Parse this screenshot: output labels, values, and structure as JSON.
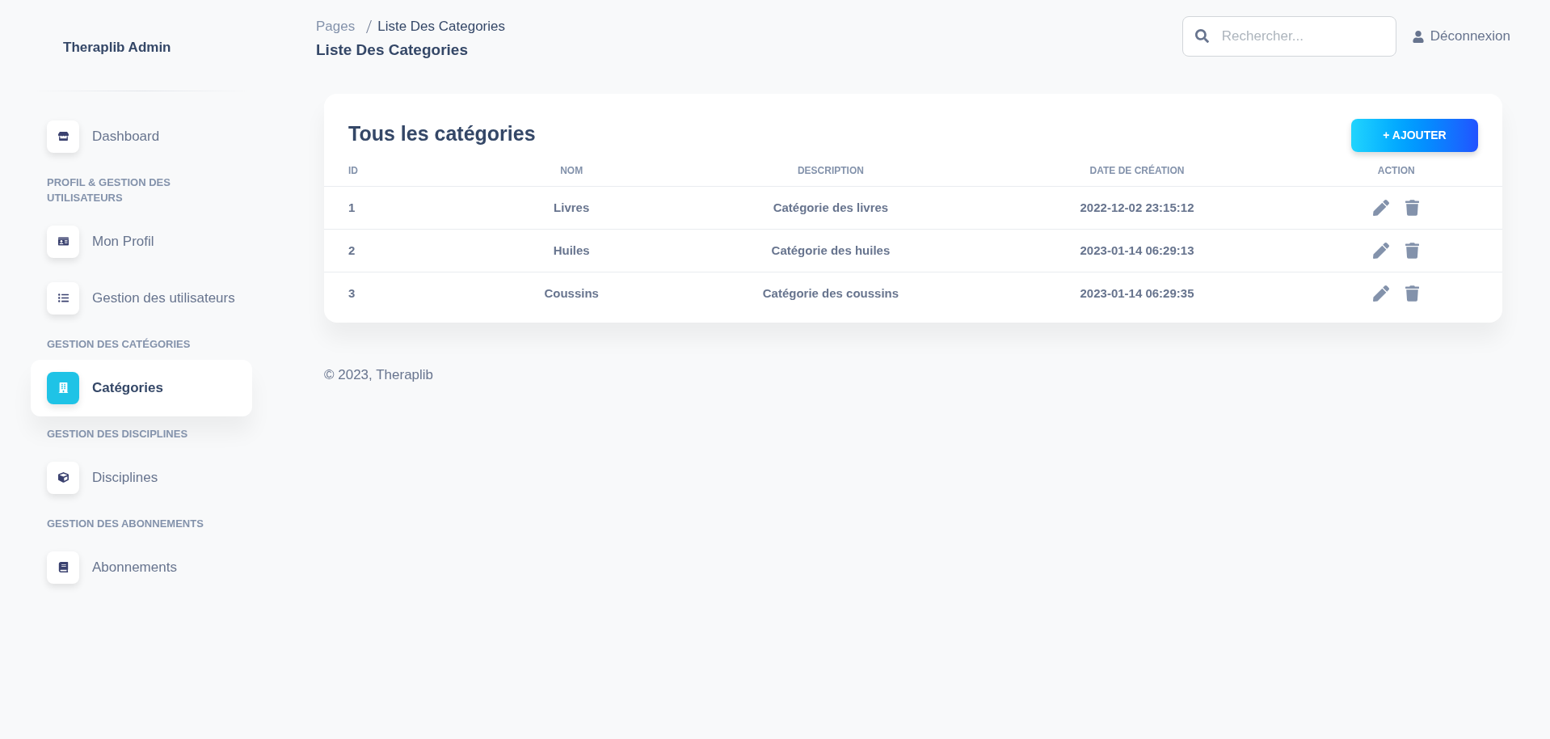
{
  "sidebar": {
    "brand": "Theraplib Admin",
    "items": [
      {
        "kind": "link",
        "label": "Dashboard",
        "selected": false
      },
      {
        "kind": "heading",
        "label": "PROFIL & GESTION DES UTILISATEURS"
      },
      {
        "kind": "link",
        "label": "Mon Profil",
        "selected": false
      },
      {
        "kind": "link",
        "label": "Gestion des utilisateurs",
        "selected": false
      },
      {
        "kind": "heading",
        "label": "GESTION DES CATÉGORIES"
      },
      {
        "kind": "link",
        "label": "Catégories",
        "selected": true
      },
      {
        "kind": "heading",
        "label": "GESTION DES DISCIPLINES"
      },
      {
        "kind": "link",
        "label": "Disciplines",
        "selected": false
      },
      {
        "kind": "heading",
        "label": "GESTION DES ABONNEMENTS"
      },
      {
        "kind": "link",
        "label": "Abonnements",
        "selected": false
      }
    ]
  },
  "header": {
    "breadcrumb": [
      "Pages",
      "Liste Des Categories"
    ],
    "title": "Liste Des Categories",
    "search": {
      "placeholder": "Rechercher..."
    },
    "logout": "Déconnexion"
  },
  "card": {
    "title": "Tous les catégories",
    "add_button": "+ AJOUTER",
    "columns": [
      "ID",
      "NOM",
      "DESCRIPTION",
      "DATE DE CRÉATION",
      "ACTION"
    ],
    "rows": [
      {
        "id": "1",
        "name": "Livres",
        "description": "Catégorie des livres",
        "created": "2022-12-02 23:15:12"
      },
      {
        "id": "2",
        "name": "Huiles",
        "description": "Catégorie des huiles",
        "created": "2023-01-14 06:29:13"
      },
      {
        "id": "3",
        "name": "Coussins",
        "description": "Catégorie des coussins",
        "created": "2023-01-14 06:29:35"
      }
    ]
  },
  "footer": "© 2023, Theraplib"
}
